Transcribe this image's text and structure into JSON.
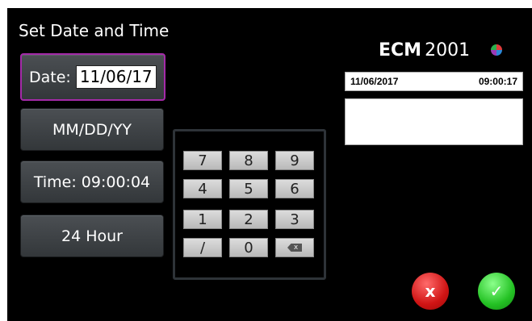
{
  "screen": {
    "title": "Set Date and Time"
  },
  "left_buttons": {
    "date_label": "Date:",
    "date_value": "11/06/17",
    "format": "MM/DD/YY",
    "time": "Time:  09:00:04",
    "hour_mode": "24 Hour"
  },
  "keypad": {
    "keys": [
      "7",
      "8",
      "9",
      "4",
      "5",
      "6",
      "1",
      "2",
      "3",
      "/",
      "0"
    ],
    "backspace_glyph": "x"
  },
  "brand": {
    "name_bold": "ECM",
    "name_light": "2001"
  },
  "info": {
    "date": "11/06/2017",
    "time": "09:00:17"
  },
  "actions": {
    "cancel": "x",
    "confirm": "✓"
  },
  "colors": {
    "selected_border": "#a42aa8",
    "cancel": "#d01414",
    "confirm": "#24c224"
  }
}
